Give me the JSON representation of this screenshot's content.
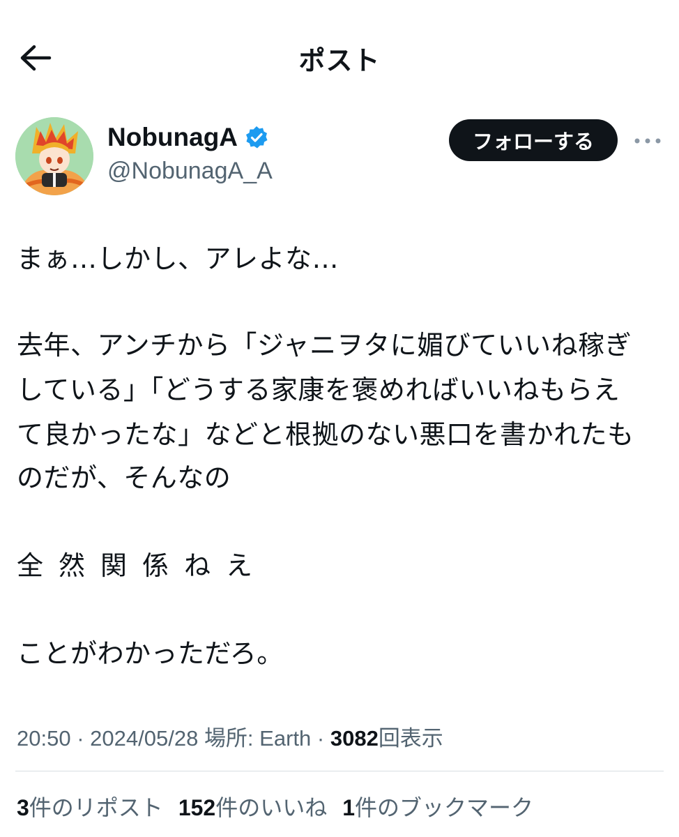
{
  "header": {
    "title": "ポスト"
  },
  "author": {
    "display_name": "NobunagA",
    "handle": "@NobunagA_A",
    "verified": true
  },
  "follow_button": {
    "label": "フォローする"
  },
  "tweet": {
    "lines": [
      "まぁ…しかし、アレよな…",
      "去年、アンチから「ジャニヲタに媚びていいね稼ぎ",
      "している」「どうする家康を褒めればいいねもらえ",
      "て良かったな」などと根拠のない悪口を書かれたも",
      "のだが、そんなの",
      "全然関係ねえ",
      "ことがわかっただろ。"
    ]
  },
  "meta": {
    "time": "20:50",
    "date": "2024/05/28",
    "location": "場所: Earth",
    "views_count": "3082",
    "views_label": "回表示",
    "separator": "·"
  },
  "stats": {
    "reposts_count": "3",
    "reposts_label": "件のリポスト",
    "likes_count": "152",
    "likes_label": "件のいいね",
    "bookmarks_count": "1",
    "bookmarks_label": "件のブックマーク"
  },
  "colors": {
    "text": "#0f1419",
    "secondary": "#536471",
    "verified_blue": "#1d9bf0",
    "follow_bg": "#0f1419"
  },
  "icons": [
    "back-arrow-icon",
    "verified-badge-icon",
    "more-options-icon"
  ]
}
